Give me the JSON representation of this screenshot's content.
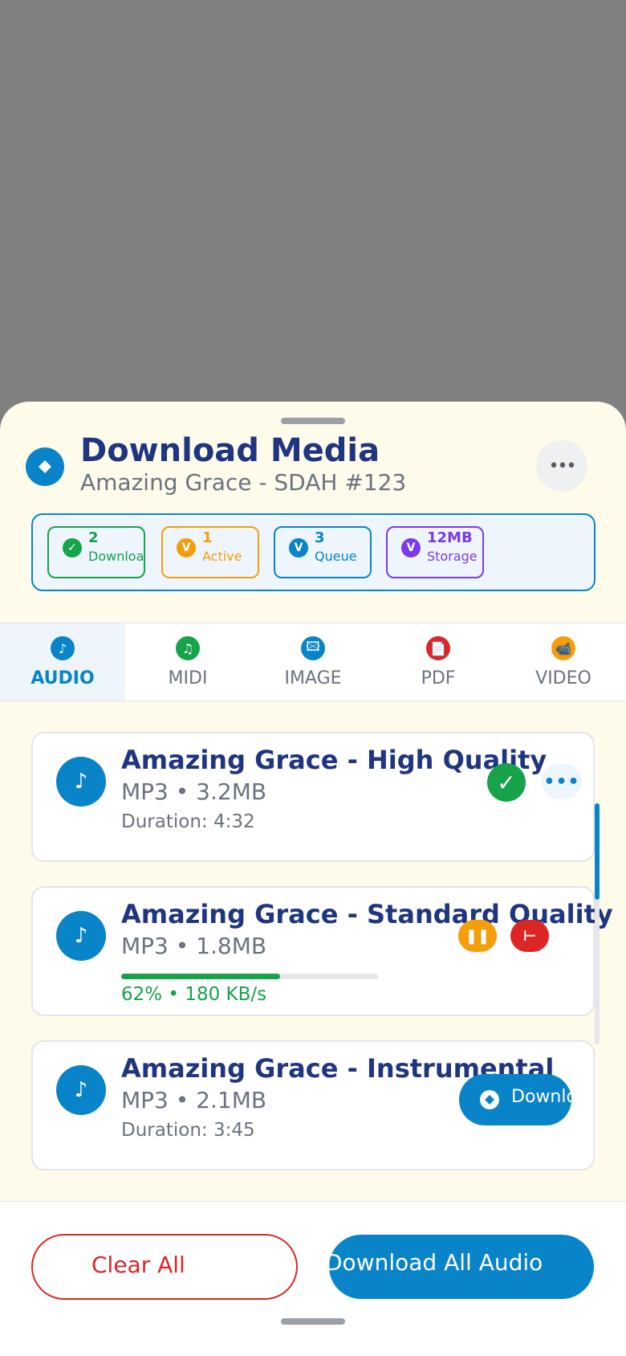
{
  "header": {
    "icon": "download-diamond-icon",
    "title": "Download Media",
    "subtitle": "Amazing Grace - SDAH #123",
    "more_icon": "•••"
  },
  "stats": [
    {
      "value": "2",
      "label": "Downloaded",
      "icon": "✓",
      "color": "#16a34a"
    },
    {
      "value": "1",
      "label": "Active",
      "icon": "V",
      "color": "#f59e0b"
    },
    {
      "value": "3",
      "label": "Queue",
      "icon": "V",
      "color": "#0a84c9"
    },
    {
      "value": "12MB",
      "label": "Storage",
      "icon": "V",
      "color": "#7c3aed"
    }
  ],
  "tabs": [
    {
      "label": "AUDIO",
      "icon": "♪",
      "color": "#0a84c9",
      "active": true
    },
    {
      "label": "MIDI",
      "icon": "♫",
      "color": "#16a34a",
      "active": false
    },
    {
      "label": "IMAGE",
      "icon": "🖾",
      "color": "#0a84c9",
      "active": false
    },
    {
      "label": "PDF",
      "icon": "📄",
      "color": "#dc2626",
      "active": false
    },
    {
      "label": "VIDEO",
      "icon": "📹",
      "color": "#f59e0b",
      "active": false
    }
  ],
  "items": [
    {
      "title": "Amazing Grace - High Quality",
      "meta": "MP3 • 3.2MB",
      "duration": "Duration: 4:32",
      "status": "downloaded",
      "done_icon": "✓",
      "more_icon": "•••"
    },
    {
      "title": "Amazing Grace - Standard Quality",
      "meta": "MP3 • 1.8MB",
      "progress": 0.62,
      "progress_text": "62% • 180 KB/s",
      "status": "downloading",
      "pause_icon": "❚❚",
      "cancel_icon": "⊢"
    },
    {
      "title": "Amazing Grace - Instrumental",
      "meta": "MP3 • 2.1MB",
      "duration": "Duration: 3:45",
      "status": "available",
      "download_label": "Download"
    }
  ],
  "footer": {
    "clear_label": "Clear All",
    "download_all_label": "Download All Audio"
  },
  "colors": {
    "accent": "#0a84c9",
    "title": "#1f3580",
    "success": "#16a34a",
    "warning": "#f59e0b",
    "danger": "#dc2626",
    "sheet": "#fefbea"
  }
}
